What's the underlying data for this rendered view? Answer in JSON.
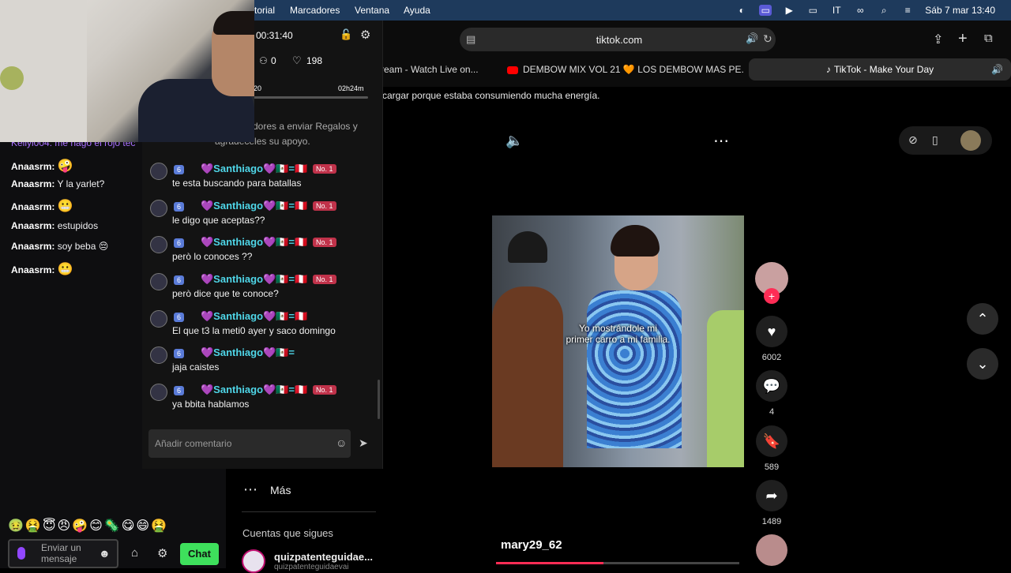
{
  "menubar": {
    "items": [
      "torial",
      "Marcadores",
      "Ventana",
      "Ayuda"
    ],
    "datetime": "Sáb 7 mar 13:40"
  },
  "browser": {
    "url": "tiktok.com",
    "tabs": [
      {
        "label": "ream - Watch Live on..."
      },
      {
        "label": "DEMBOW MIX VOL 21 🧡 LOS DEMBOW MAS PE..."
      },
      {
        "label": "TikTok - Make Your Day"
      }
    ]
  },
  "page": {
    "banner_text": "cargar porque estaba consumiendo mucha energía."
  },
  "live": {
    "timer": "00:31:40",
    "viewers": "0",
    "likes": "198",
    "progress_left": "20",
    "progress_right": "02h24m",
    "gift_text_1": "dores a enviar Regalos y",
    "gift_text_2": "agradeceles su apoyo.",
    "username": "💜Santhiago💜🇲🇽=🇵🇪",
    "username_short": "💜Santhiago💜🇲🇽=",
    "level": "6",
    "no1": "No. 1",
    "messages": [
      {
        "text": "te esta buscando para batallas"
      },
      {
        "text": "le digo que aceptas??"
      },
      {
        "text": "però lo conoces ??"
      },
      {
        "text": "però dice que te conoce?"
      },
      {
        "text": "El que t3 la meti0 ayer y saco domingo"
      },
      {
        "text": "jaja caistes"
      },
      {
        "text": "ya bbita hablamos"
      }
    ],
    "comment_placeholder": "Añadir comentario"
  },
  "twitch": {
    "partial_line": "Kellyl004: me hago el rojo tec",
    "lines": [
      {
        "user": "Anaasrm:",
        "text": "🤪"
      },
      {
        "user": "Anaasrm:",
        "text": "Y la yarlet?"
      },
      {
        "user": "Anaasrm:",
        "text": "😬"
      },
      {
        "user": "Anaasrm:",
        "text": "estupidos"
      },
      {
        "user": "Anaasrm:",
        "text": "soy beba 😔"
      },
      {
        "user": "Anaasrm:",
        "text": "😬"
      }
    ],
    "emotes": "🤢🤮😇😠🤪😊🦠😋😄🤮",
    "input_placeholder_1": "Enviar un",
    "input_placeholder_2": "mensaje",
    "chat_button": "Chat"
  },
  "tiktok": {
    "more_label": "Más",
    "following_title": "Cuentas que sigues",
    "following_account": "quizpatenteguidae...",
    "following_sub": "quizpatenteguidaevai",
    "video_caption_1": "Yo mostrándole mi",
    "video_caption_2": "primer carro a mi familia.",
    "author": "mary29_62",
    "likes": "6002",
    "comments": "4",
    "saves": "589",
    "shares": "1489"
  }
}
